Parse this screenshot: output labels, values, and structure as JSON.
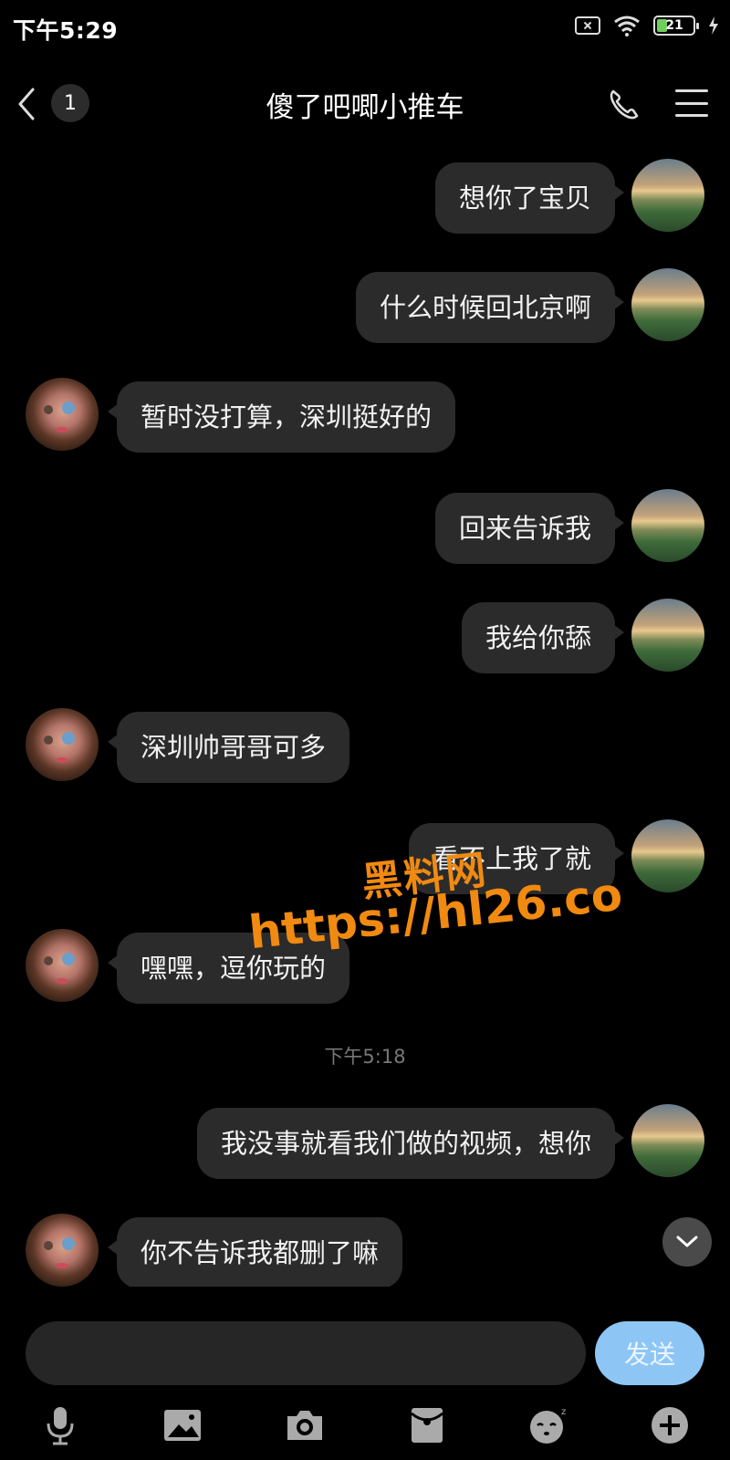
{
  "status_bar": {
    "time": "下午5:29",
    "battery_level": "21",
    "icons": [
      "sim-off-icon",
      "wifi-icon",
      "battery-icon",
      "charging-icon"
    ]
  },
  "header": {
    "unread_count": "1",
    "title": "傻了吧唧小推车",
    "icons": [
      "back-icon",
      "phone-icon",
      "menu-icon"
    ]
  },
  "messages": [
    {
      "side": "me",
      "text": "想你了宝贝"
    },
    {
      "side": "me",
      "text": "什么时候回北京啊"
    },
    {
      "side": "other",
      "text": "暂时没打算，深圳挺好的"
    },
    {
      "side": "me",
      "text": "回来告诉我"
    },
    {
      "side": "me",
      "text": "我给你舔"
    },
    {
      "side": "other",
      "text": "深圳帅哥哥可多"
    },
    {
      "side": "me",
      "text": "看不上我了就"
    },
    {
      "side": "other",
      "text": "嘿嘿，逗你玩的"
    },
    {
      "side": "me",
      "text": "我没事就看我们做的视频，想你"
    },
    {
      "side": "other",
      "text": "你不告诉我都删了嘛"
    }
  ],
  "timestamp": "下午5:18",
  "watermark": {
    "line1": "黑料网",
    "line2": "https://hl26.co"
  },
  "composer": {
    "input_value": "",
    "send_label": "发送"
  },
  "toolbar_icons": [
    "microphone-icon",
    "image-icon",
    "camera-icon",
    "red-packet-icon",
    "emoji-icon",
    "plus-icon"
  ],
  "colors": {
    "background": "#000000",
    "bubble": "#2b2b2b",
    "send_button": "#8dc6f5",
    "watermark": "#f08a10",
    "battery_fill": "#6ecf5a"
  }
}
